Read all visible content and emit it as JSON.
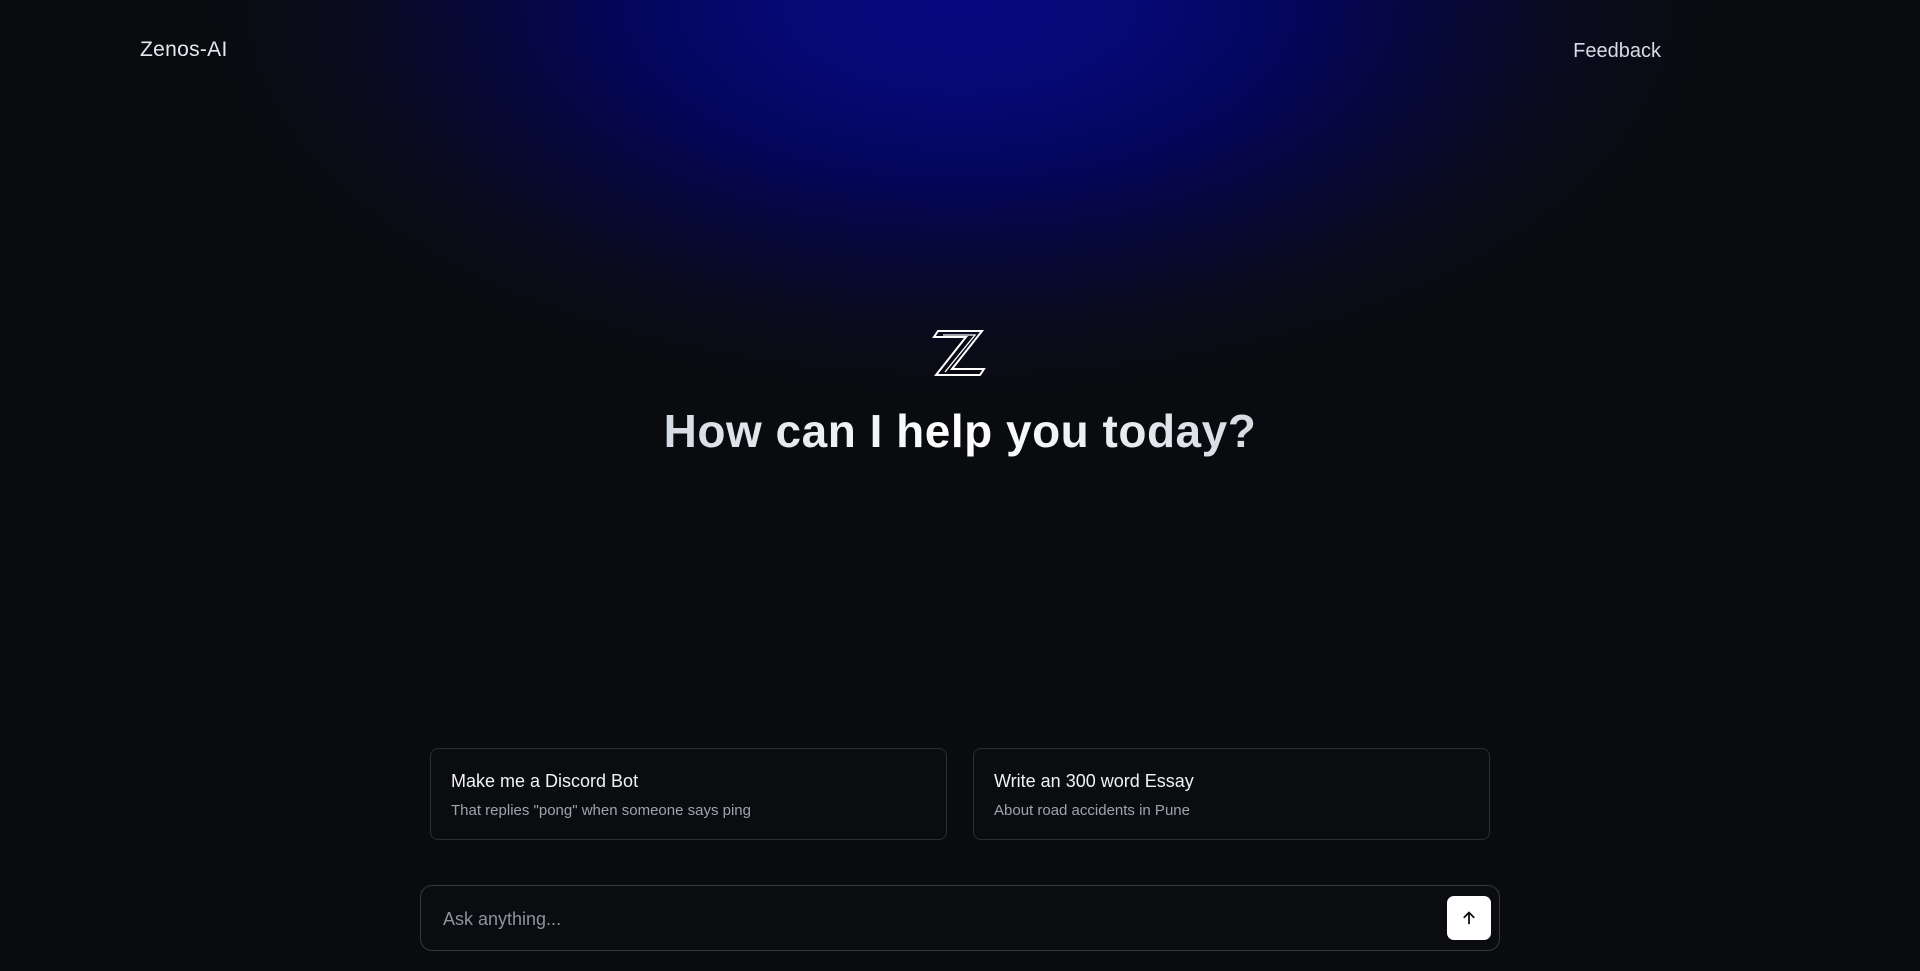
{
  "header": {
    "brand": "Zenos-AI",
    "feedback_label": "Feedback"
  },
  "hero": {
    "logo_icon": "z-logo-icon",
    "headline": "How can I help you today?"
  },
  "suggestions": [
    {
      "title": "Make me a Discord Bot",
      "subtitle": "That replies \"pong\" when someone says ping"
    },
    {
      "title": "Write an 300 word Essay",
      "subtitle": "About road accidents in Pune"
    }
  ],
  "composer": {
    "placeholder": "Ask anything...",
    "value": "",
    "send_icon": "arrow-up-icon"
  },
  "colors": {
    "background": "#0a0b0e",
    "glow": "#07087f",
    "send_button": "#ffffff"
  }
}
